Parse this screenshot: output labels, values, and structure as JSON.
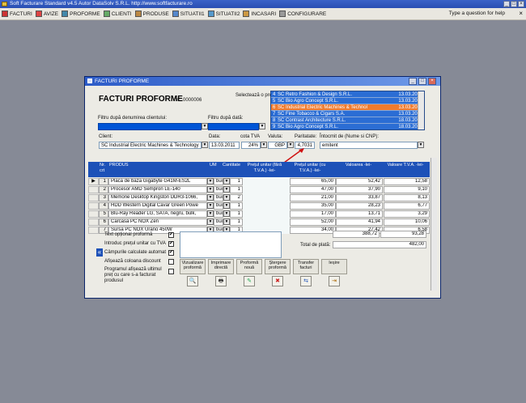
{
  "app": {
    "title": "Soft Facturare Standard v4.5 Autor DataSolv S.R.L. http://www.softfacturare.ro",
    "window_buttons": [
      "_",
      "□",
      "×"
    ]
  },
  "menubar": {
    "items": [
      "FACTURI",
      "AVIZE",
      "PROFORME",
      "CLIENTI",
      "PRODUSE",
      "SITUATII1",
      "SITUATII2",
      "INCASARI",
      "CONFIGURARE"
    ],
    "help_placeholder": "Type a question for help",
    "close_glyph": "×"
  },
  "window": {
    "title": "FACTURI PROFORME",
    "heading": "FACTURI PROFORME",
    "nr_label": "nr.",
    "nr_value": "0000006",
    "select_label": "Selectează o proformă:",
    "filter_client_label": "Filtru după denumirea clientului:",
    "filter_date_label": "Filtru după dată:",
    "proformas": [
      {
        "n": "4",
        "client": "SC Retro Fashion & Design S.R.L.",
        "date": "13.03.2011",
        "selected": false
      },
      {
        "n": "5",
        "client": "SC Bio Agro Concept S.R.L.",
        "date": "13.03.2011",
        "selected": false
      },
      {
        "n": "6",
        "client": "SC Industrial Electric Machines & Technol",
        "date": "13.03.2011",
        "selected": true
      },
      {
        "n": "7",
        "client": "SC Fine Tobacco & Cigars S.A.",
        "date": "13.03.2011",
        "selected": false
      },
      {
        "n": "8",
        "client": "SC Contrast Architecture S.R.L.",
        "date": "18.03.2011",
        "selected": false
      },
      {
        "n": "9",
        "client": "SC Bio Agro Concept S.R.L.",
        "date": "18.03.2011",
        "selected": false
      }
    ],
    "client_label": "Client:",
    "client_value": "SC Industrial Electric Machines & Technology",
    "data_label": "Data:",
    "data_value": "13.03.2011",
    "tva_label": "cota TVA",
    "tva_value": "24%",
    "valuta_label": "Valuta:",
    "valuta_value": "GBP",
    "paritate_label": "Paritatate:",
    "paritate_value": "4,7031",
    "intocmit_label": "Întocmit de (Nume si CNP):",
    "intocmit_value": "emitent",
    "columns": [
      "Nr. crt",
      "PRODUS",
      "UM",
      "Cantitate",
      "Prețul unitar (fără T.V.A.) -lei-",
      "Prețul unitar (cu T.V.A.) -lei-",
      "Valoarea -lei-",
      "Valoare T.V.A. -lei-"
    ],
    "rows": [
      {
        "nr": "1",
        "produs": "Placa de baza Gigabyte G41M-ES2L",
        "um": "buc",
        "cant": "1",
        "pu_cu": "65,00",
        "valoare": "52,42",
        "tva": "12,58"
      },
      {
        "nr": "2",
        "produs": "Procesor AMD Sempron LE-140",
        "um": "buc",
        "cant": "1",
        "pu_cu": "47,00",
        "valoare": "37,90",
        "tva": "9,10"
      },
      {
        "nr": "3",
        "produs": "Memorie Desktop Kingston DDR3-1066,",
        "um": "buc",
        "cant": "2",
        "pu_cu": "21,00",
        "valoare": "33,87",
        "tva": "8,13"
      },
      {
        "nr": "4",
        "produs": "HDD Western Digital Cavar Green Powe",
        "um": "buc",
        "cant": "1",
        "pu_cu": "35,00",
        "valoare": "28,23",
        "tva": "6,77"
      },
      {
        "nr": "5",
        "produs": "Blu-Ray Reader LG, SATA, negru, bulk,",
        "um": "buc",
        "cant": "1",
        "pu_cu": "17,00",
        "valoare": "13,71",
        "tva": "3,29"
      },
      {
        "nr": "6",
        "produs": "Carcasa PC NOX Zen",
        "um": "buc",
        "cant": "1",
        "pu_cu": "52,00",
        "valoare": "41,94",
        "tva": "10,06"
      },
      {
        "nr": "7",
        "produs": "Sursa PC NOX Urano 450W",
        "um": "buc",
        "cant": "1",
        "pu_cu": "34,00",
        "valoare": "27,42",
        "tva": "6,58"
      }
    ],
    "total_valoare": "388,72",
    "total_tva": "93,28",
    "total_plata_label": "Total de plată:",
    "total_plata": "482,00",
    "options": [
      {
        "label": "Text opțional proformă",
        "checked": true
      },
      {
        "label": "Introduc prețul unitar cu TVA",
        "checked": true
      },
      {
        "label": "Câmpurile calculate automat",
        "checked": true
      },
      {
        "label": "Afișează coloana discount",
        "checked": false
      },
      {
        "label": "Programul afișează ultimul preț cu care s-a facturat produsul",
        "checked": false
      }
    ],
    "collapse_glyph": "«",
    "buttons": [
      {
        "label": "Vizualizare proformă",
        "icon": "preview-icon",
        "glyph": "🔍"
      },
      {
        "label": "Imprimare directă",
        "icon": "printer-icon",
        "glyph": "🖶"
      },
      {
        "label": "Proformă nouă",
        "icon": "new-document-icon",
        "glyph": "✎"
      },
      {
        "label": "Ștergere proformă",
        "icon": "delete-icon",
        "glyph": "✖"
      },
      {
        "label": "Transfer facturi",
        "icon": "transfer-icon",
        "glyph": "⇆"
      },
      {
        "label": "Ieșire",
        "icon": "exit-icon",
        "glyph": "⇥"
      }
    ],
    "checkmark": "✔",
    "dropdown_glyph": "▼",
    "row_marker": "▶"
  }
}
